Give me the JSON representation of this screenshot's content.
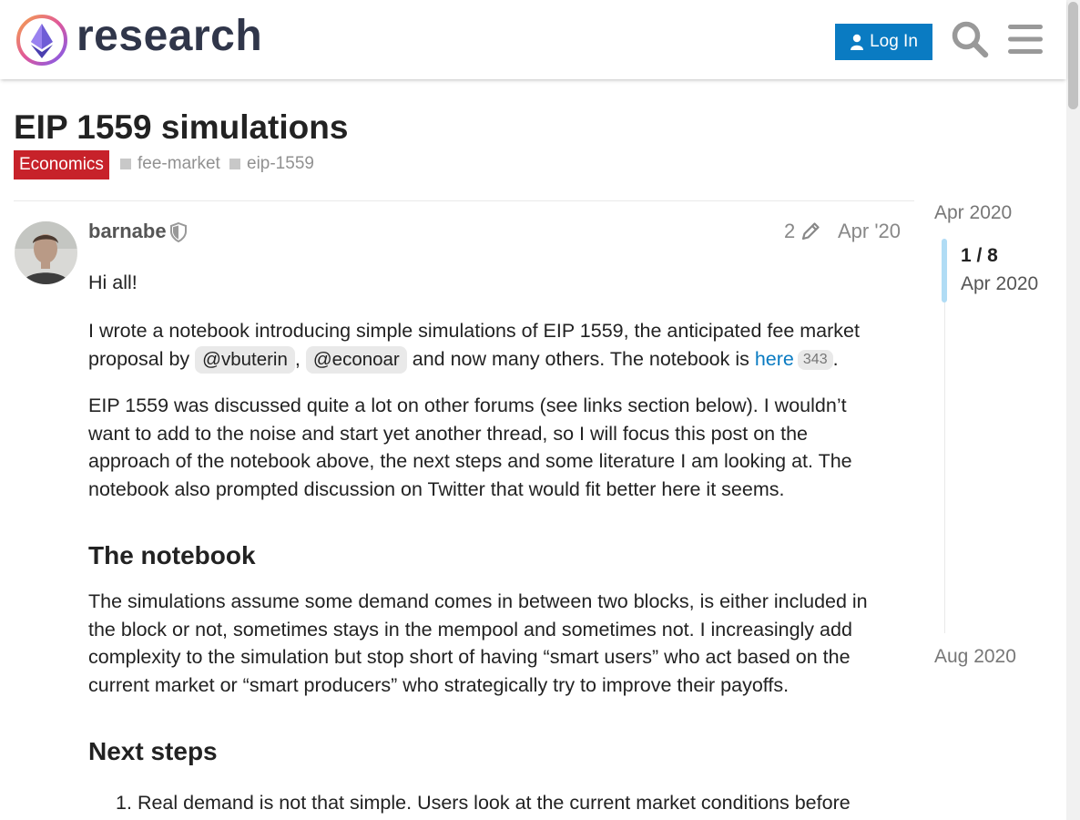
{
  "header": {
    "logo_text": "research",
    "login_label": "Log In",
    "colors": {
      "login_bg": "#0a7bc2",
      "logo_text": "#30364a"
    }
  },
  "topic": {
    "title": "EIP 1559 simulations",
    "category": "Economics",
    "category_color": "#c7222a",
    "tags": [
      "fee-market",
      "eip-1559"
    ]
  },
  "post": {
    "username": "barnabe",
    "edit_count": "2",
    "date": "Apr '20",
    "p1": "Hi all!",
    "p2_a": "I wrote a notebook introducing simple simulations of EIP 1559, the anticipated fee market proposal by",
    "mention_1": "@vbuterin",
    "comma": ",",
    "mention_2": "@econoar",
    "p2_b": "and now many others. The notebook is",
    "link_text": "here",
    "link_clicks": "343",
    "period": ".",
    "p3": "EIP 1559 was discussed quite a lot on other forums (see links section below). I wouldn’t want to add to the noise and start yet another thread, so I will focus this post on the approach of the notebook above, the next steps and some literature I am looking at. The notebook also prompted discussion on Twitter that would fit better here it seems.",
    "heading_1": "The notebook",
    "p4": "The simulations assume some demand comes in between two blocks, is either included in the block or not, sometimes stays in the mempool and sometimes not. I increasingly add complexity to the simulation but stop short of having “smart users” who act based on the current market or “smart producers” who strategically try to improve their payoffs.",
    "heading_2": "Next steps",
    "list_num": "1.",
    "list_item_1": "Real demand is not that simple. Users look at the current market conditions before"
  },
  "timeline": {
    "start": "Apr 2020",
    "position": "1 / 8",
    "position_date": "Apr 2020",
    "end": "Aug 2020",
    "progress": 0.125
  }
}
